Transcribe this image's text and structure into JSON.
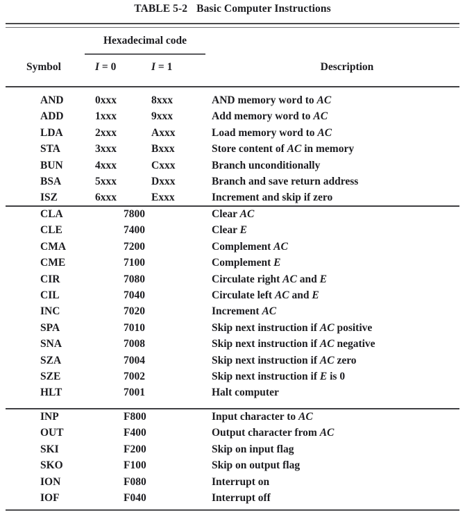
{
  "caption": {
    "label": "TABLE",
    "number": "5-2",
    "title": "Basic Computer Instructions"
  },
  "header": {
    "symbol": "Symbol",
    "hex_group": "Hexadecimal code",
    "i0": "I = 0",
    "i1": "I = 1",
    "description": "Description"
  },
  "table_data": {
    "type": "table",
    "columns": [
      "Symbol",
      "I = 0",
      "I = 1",
      "Description"
    ],
    "blocks": [
      {
        "name": "memory-reference-instructions",
        "two_hex_columns": true,
        "rows": [
          {
            "symbol": "AND",
            "hex0": "0xxx",
            "hex1": "8xxx",
            "desc_pre": "AND memory word to ",
            "desc_em": "AC",
            "desc_post": ""
          },
          {
            "symbol": "ADD",
            "hex0": "1xxx",
            "hex1": "9xxx",
            "desc_pre": "Add memory word to ",
            "desc_em": "AC",
            "desc_post": ""
          },
          {
            "symbol": "LDA",
            "hex0": "2xxx",
            "hex1": "Axxx",
            "desc_pre": "Load memory word to ",
            "desc_em": "AC",
            "desc_post": ""
          },
          {
            "symbol": "STA",
            "hex0": "3xxx",
            "hex1": "Bxxx",
            "desc_pre": "Store content of ",
            "desc_em": "AC",
            "desc_post": " in memory"
          },
          {
            "symbol": "BUN",
            "hex0": "4xxx",
            "hex1": "Cxxx",
            "desc_pre": "Branch unconditionally",
            "desc_em": "",
            "desc_post": ""
          },
          {
            "symbol": "BSA",
            "hex0": "5xxx",
            "hex1": "Dxxx",
            "desc_pre": "Branch and save return address",
            "desc_em": "",
            "desc_post": ""
          },
          {
            "symbol": "ISZ",
            "hex0": "6xxx",
            "hex1": "Exxx",
            "desc_pre": "Increment and skip if zero",
            "desc_em": "",
            "desc_post": ""
          }
        ]
      },
      {
        "name": "register-reference-instructions",
        "two_hex_columns": false,
        "rows": [
          {
            "symbol": "CLA",
            "hex": "7800",
            "desc_pre": "Clear ",
            "desc_em": "AC",
            "desc_post": ""
          },
          {
            "symbol": "CLE",
            "hex": "7400",
            "desc_pre": "Clear ",
            "desc_em": "E",
            "desc_post": ""
          },
          {
            "symbol": "CMA",
            "hex": "7200",
            "desc_pre": "Complement ",
            "desc_em": "AC",
            "desc_post": ""
          },
          {
            "symbol": "CME",
            "hex": "7100",
            "desc_pre": "Complement ",
            "desc_em": "E",
            "desc_post": ""
          },
          {
            "symbol": "CIR",
            "hex": "7080",
            "desc_pre": "Circulate right ",
            "desc_em": "AC",
            "desc_post": " and E"
          },
          {
            "symbol": "CIL",
            "hex": "7040",
            "desc_pre": "Circulate left ",
            "desc_em": "AC",
            "desc_post": " and E"
          },
          {
            "symbol": "INC",
            "hex": "7020",
            "desc_pre": "Increment  ",
            "desc_em": "AC",
            "desc_post": ""
          },
          {
            "symbol": "SPA",
            "hex": "7010",
            "desc_pre": "Skip next instruction if ",
            "desc_em": "AC",
            "desc_post": " positive"
          },
          {
            "symbol": "SNA",
            "hex": "7008",
            "desc_pre": "Skip next instruction if ",
            "desc_em": "AC",
            "desc_post": " negative"
          },
          {
            "symbol": "SZA",
            "hex": "7004",
            "desc_pre": "Skip next instruction if ",
            "desc_em": "AC",
            "desc_post": " zero"
          },
          {
            "symbol": "SZE",
            "hex": "7002",
            "desc_pre": "Skip next instruction if ",
            "desc_em": "E",
            "desc_post": " is 0"
          },
          {
            "symbol": "HLT",
            "hex": "7001",
            "desc_pre": "Halt computer",
            "desc_em": "",
            "desc_post": ""
          }
        ]
      },
      {
        "name": "input-output-instructions",
        "two_hex_columns": false,
        "rows": [
          {
            "symbol": "INP",
            "hex": "F800",
            "desc_pre": "Input character to ",
            "desc_em": "AC",
            "desc_post": ""
          },
          {
            "symbol": "OUT",
            "hex": "F400",
            "desc_pre": "Output character from ",
            "desc_em": "AC",
            "desc_post": ""
          },
          {
            "symbol": "SKI",
            "hex": "F200",
            "desc_pre": "Skip on input flag",
            "desc_em": "",
            "desc_post": ""
          },
          {
            "symbol": "SKO",
            "hex": "F100",
            "desc_pre": "Skip on output flag",
            "desc_em": "",
            "desc_post": ""
          },
          {
            "symbol": "ION",
            "hex": "F080",
            "desc_pre": "Interrupt on",
            "desc_em": "",
            "desc_post": ""
          },
          {
            "symbol": "IOF",
            "hex": "F040",
            "desc_pre": "Interrupt off",
            "desc_em": "",
            "desc_post": ""
          }
        ]
      }
    ]
  }
}
